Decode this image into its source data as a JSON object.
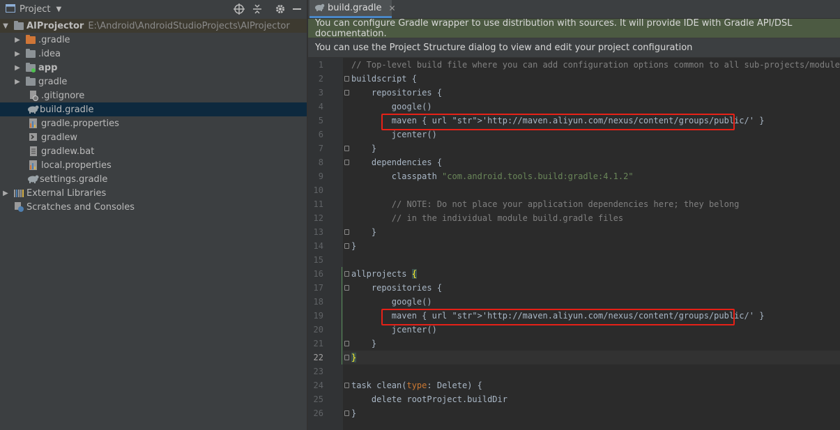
{
  "project_panel": {
    "title": "Project",
    "tree": [
      {
        "label": "AIProjector",
        "path": "E:\\Android\\AndroidStudioProjects\\AIProjector"
      },
      {
        "label": ".gradle"
      },
      {
        "label": ".idea"
      },
      {
        "label": "app"
      },
      {
        "label": "gradle"
      },
      {
        "label": ".gitignore"
      },
      {
        "label": "build.gradle"
      },
      {
        "label": "gradle.properties"
      },
      {
        "label": "gradlew"
      },
      {
        "label": "gradlew.bat"
      },
      {
        "label": "local.properties"
      },
      {
        "label": "settings.gradle"
      },
      {
        "label": "External Libraries"
      },
      {
        "label": "Scratches and Consoles"
      }
    ]
  },
  "editor": {
    "tab_label": "build.gradle",
    "banner_wrapper": "You can configure Gradle wrapper to use distribution with sources. It will provide IDE with Gradle API/DSL documentation.",
    "banner_structure": "You can use the Project Structure dialog to view and edit your project configuration",
    "current_line": 22,
    "lines": [
      "// Top-level build file where you can add configuration options common to all sub-projects/modules.",
      "buildscript {",
      "    repositories {",
      "        google()",
      "        maven { url 'http://maven.aliyun.com/nexus/content/groups/public/' }",
      "        jcenter()",
      "    }",
      "    dependencies {",
      "        classpath \"com.android.tools.build:gradle:4.1.2\"",
      "",
      "        // NOTE: Do not place your application dependencies here; they belong",
      "        // in the individual module build.gradle files",
      "    }",
      "}",
      "",
      "allprojects {",
      "    repositories {",
      "        google()",
      "        maven { url 'http://maven.aliyun.com/nexus/content/groups/public/' }",
      "        jcenter()",
      "    }",
      "}",
      "",
      "task clean(type: Delete) {",
      "    delete rootProject.buildDir",
      "}"
    ]
  },
  "colors": {
    "keyword": "#cc7832",
    "string": "#6a8759",
    "comment": "#808080",
    "highlight_box": "#e62117",
    "selection": "#0d293e"
  }
}
